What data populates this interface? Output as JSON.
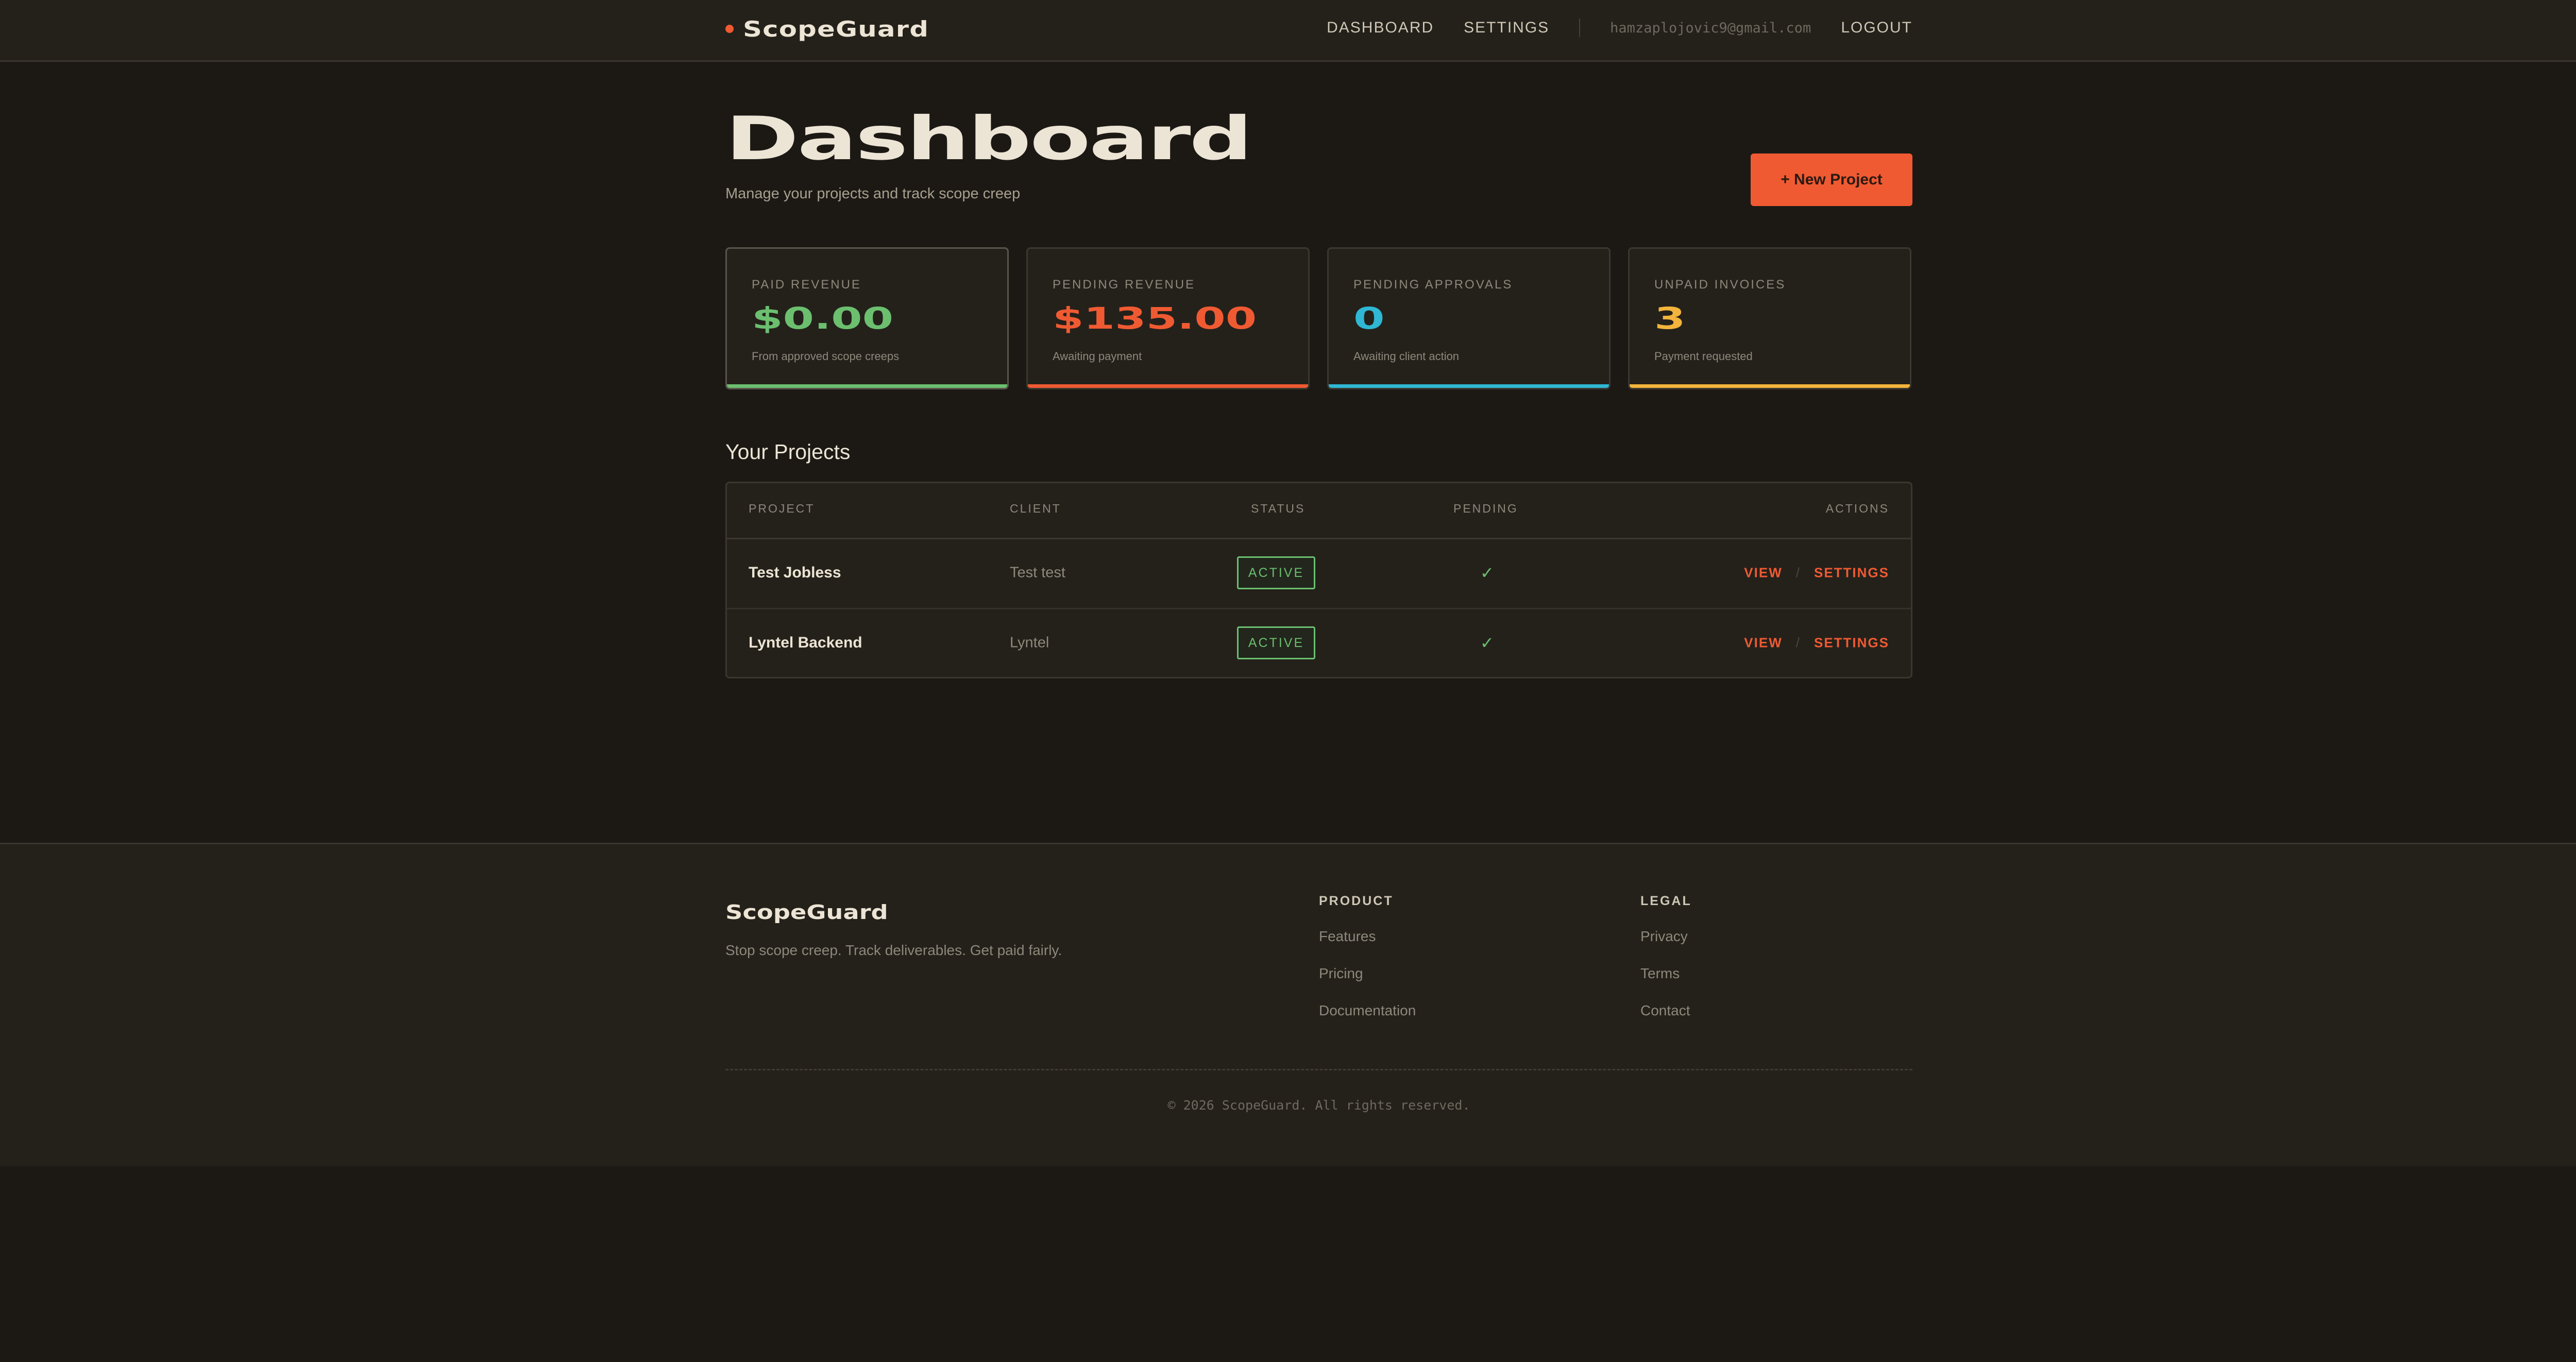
{
  "header": {
    "logo": "ScopeGuard",
    "nav": {
      "dashboard": "DASHBOARD",
      "settings": "SETTINGS",
      "email": "hamzaplojovic9@gmail.com",
      "logout": "LOGOUT"
    }
  },
  "page": {
    "title": "Dashboard",
    "subtitle": "Manage your projects and track scope creep",
    "new_project_label": "+ New Project"
  },
  "stats": [
    {
      "label": "PAID REVENUE",
      "value": "$0.00",
      "note": "From approved scope creeps",
      "color": "#6bbf6f"
    },
    {
      "label": "PENDING REVENUE",
      "value": "$135.00",
      "note": "Awaiting payment",
      "color": "#f05a32"
    },
    {
      "label": "PENDING APPROVALS",
      "value": "0",
      "note": "Awaiting client action",
      "color": "#2fb7d4"
    },
    {
      "label": "UNPAID INVOICES",
      "value": "3",
      "note": "Payment requested",
      "color": "#f2b43c"
    }
  ],
  "projects": {
    "title": "Your Projects",
    "columns": {
      "project": "PROJECT",
      "client": "CLIENT",
      "status": "STATUS",
      "pending": "PENDING",
      "actions": "ACTIONS"
    },
    "rows": [
      {
        "project": "Test Jobless",
        "client": "Test test",
        "status": "ACTIVE",
        "pending": "✓",
        "view": "VIEW",
        "sep": "/",
        "settings": "SETTINGS"
      },
      {
        "project": "Lyntel Backend",
        "client": "Lyntel",
        "status": "ACTIVE",
        "pending": "✓",
        "view": "VIEW",
        "sep": "/",
        "settings": "SETTINGS"
      }
    ]
  },
  "footer": {
    "logo": "ScopeGuard",
    "tagline": "Stop scope creep. Track deliverables. Get paid fairly.",
    "product": {
      "heading": "PRODUCT",
      "links": [
        "Features",
        "Pricing",
        "Documentation"
      ]
    },
    "legal": {
      "heading": "LEGAL",
      "links": [
        "Privacy",
        "Terms",
        "Contact"
      ]
    },
    "copyright": "© 2026 ScopeGuard. All rights reserved."
  }
}
